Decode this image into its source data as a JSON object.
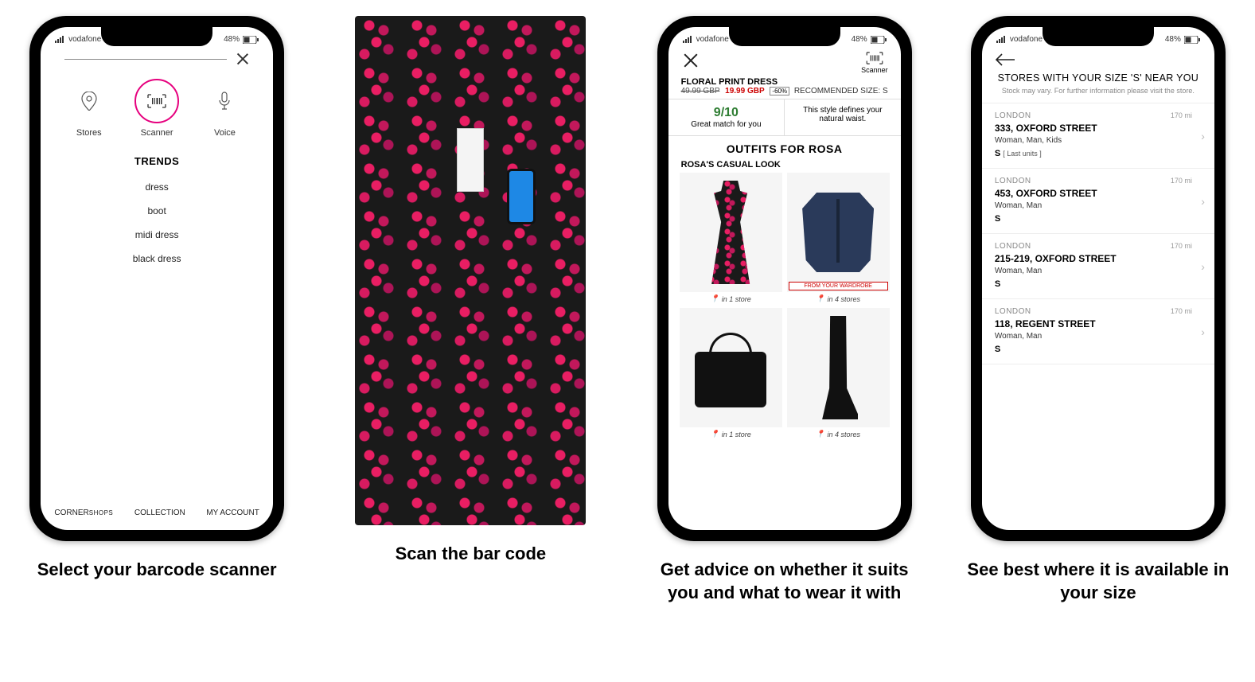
{
  "status": {
    "carrier": "vodafone UK",
    "battery": "48%"
  },
  "captions": {
    "c1": "Select your barcode scanner",
    "c2": "Scan the bar code",
    "c3": "Get advice on whether it suits you and what to wear it with",
    "c4": "See best where it is available in your size"
  },
  "screen1": {
    "icons": {
      "stores": "Stores",
      "scanner": "Scanner",
      "voice": "Voice"
    },
    "trends_header": "TRENDS",
    "trends": [
      "dress",
      "boot",
      "midi dress",
      "black dress"
    ],
    "bottom": {
      "corner": "CORNER",
      "shops": "SHOPS",
      "collection": "COLLECTION",
      "account": "MY ACCOUNT"
    }
  },
  "screen3": {
    "scanner_label": "Scanner",
    "product_title": "FLORAL PRINT DRESS",
    "old_price": "49.99 GBP",
    "new_price": "19.99 GBP",
    "discount": "-60%",
    "recommended": "RECOMMENDED SIZE: S",
    "score": "9/10",
    "score_sub": "Great match for you",
    "fit_text": "This style defines your natural waist.",
    "outfits_header": "OUTFITS FOR ROSA",
    "look_title": "ROSA'S CASUAL LOOK",
    "wardrobe_tag": "FROM YOUR WARDROBE",
    "stores": {
      "s1": "in 1 store",
      "s4": "in 4 stores"
    }
  },
  "screen4": {
    "title": "STORES WITH YOUR SIZE 'S' NEAR YOU",
    "subtitle": "Stock may vary. For further information please visit the store.",
    "items": [
      {
        "city": "LONDON",
        "addr": "333, OXFORD STREET",
        "cat": "Woman, Man, Kids",
        "size": "S",
        "last_units": "[ Last units ]",
        "dist": "170 mi"
      },
      {
        "city": "LONDON",
        "addr": "453, OXFORD STREET",
        "cat": "Woman, Man",
        "size": "S",
        "last_units": "",
        "dist": "170 mi"
      },
      {
        "city": "LONDON",
        "addr": "215-219, OXFORD STREET",
        "cat": "Woman, Man",
        "size": "S",
        "last_units": "",
        "dist": "170 mi"
      },
      {
        "city": "LONDON",
        "addr": "118, REGENT STREET",
        "cat": "Woman, Man",
        "size": "S",
        "last_units": "",
        "dist": "170 mi"
      }
    ]
  }
}
